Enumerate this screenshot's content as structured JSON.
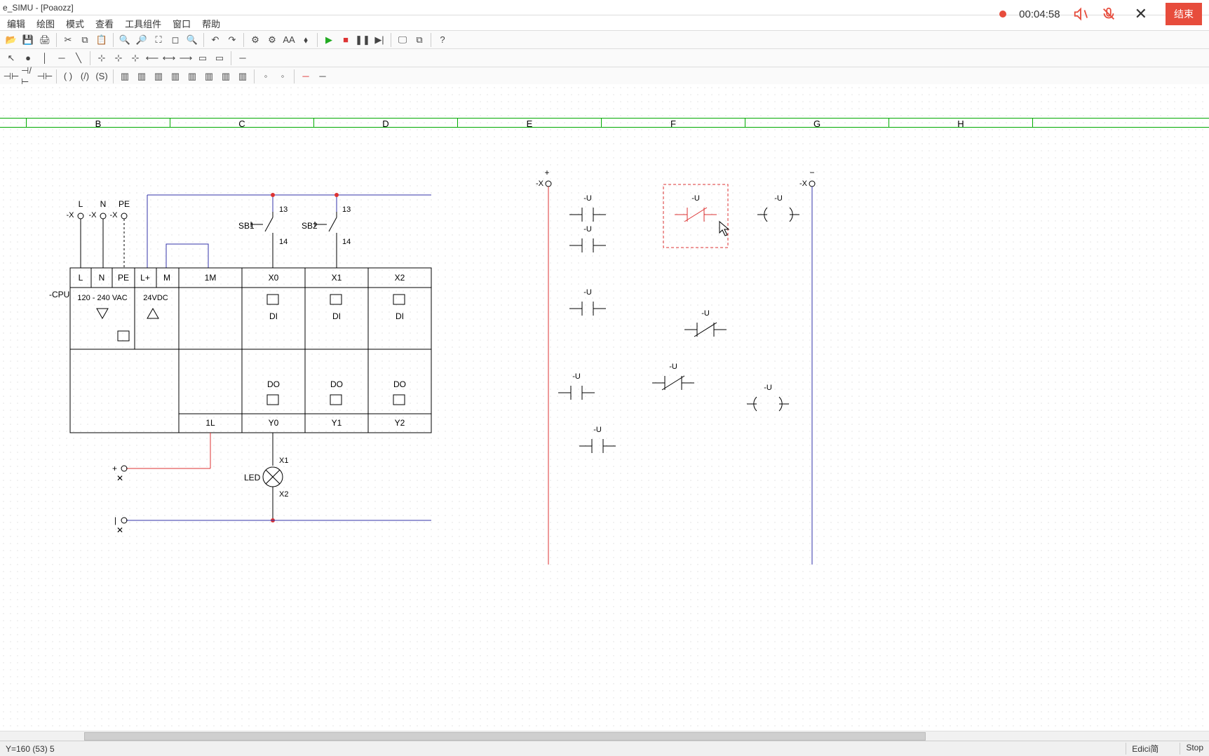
{
  "title": "e_SIMU - [Poaozz]",
  "menu": [
    "编辑",
    "绘图",
    "模式",
    "查看",
    "工具组件",
    "窗口",
    "帮助"
  ],
  "recording": {
    "time": "00:04:58",
    "end_label": "结束"
  },
  "ruler_cols": [
    "",
    "B",
    "C",
    "D",
    "E",
    "F",
    "G",
    "H"
  ],
  "status": {
    "coords": "Y=160 (53) 5",
    "mode": "Edici简",
    "run": "Stop"
  },
  "plc": {
    "cpu_label": "-CPU",
    "power_terms": [
      "L",
      "N",
      "PE"
    ],
    "power_x": [
      "-X",
      "-X",
      "-X"
    ],
    "lp": "L+",
    "m": "M",
    "vac": "120 - 240 VAC",
    "vdc": "24VDC",
    "m1": "1M",
    "l1": "1L",
    "di": [
      "X0",
      "X1",
      "X2"
    ],
    "di_lbl": "DI",
    "do": [
      "Y0",
      "Y1",
      "Y2"
    ],
    "do_lbl": "DO",
    "sb1": "SB1",
    "sb2": "SB2",
    "t13": "13",
    "t14": "14",
    "led": "LED",
    "led_x1": "X1",
    "led_x2": "X2",
    "plus": "+"
  },
  "ladder": {
    "plus": "+",
    "minus": "−",
    "xl": "-X",
    "xr": "-X",
    "no": "-U",
    "nc": "-U",
    "coil": "-U"
  }
}
